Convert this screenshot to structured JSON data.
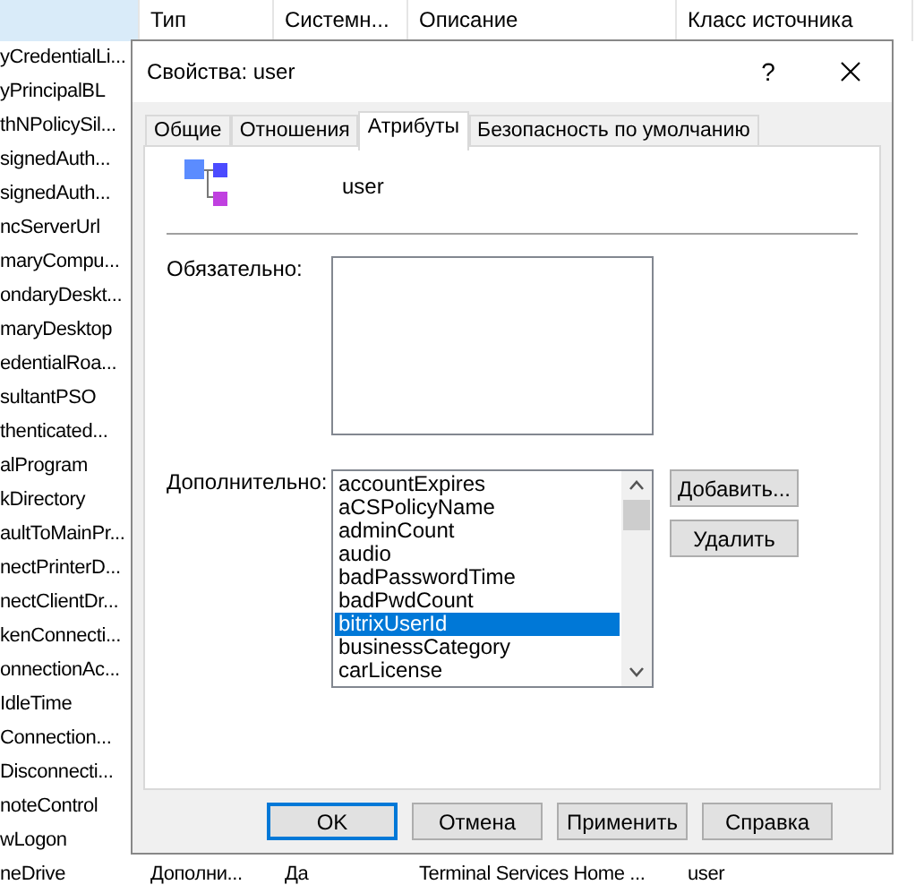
{
  "list": {
    "columns": [
      {
        "selected": true
      },
      {
        "label": "Тип",
        "selected": false
      },
      {
        "label": "Системн...",
        "selected": false
      },
      {
        "label": "Описание",
        "selected": false
      },
      {
        "label": "Класс источника",
        "selected": false
      }
    ],
    "rows": [
      {
        "cells": [
          "yCredentialLi..."
        ]
      },
      {
        "cells": [
          "yPrincipalBL"
        ]
      },
      {
        "cells": [
          "thNPolicySil..."
        ]
      },
      {
        "cells": [
          "signedAuth..."
        ]
      },
      {
        "cells": [
          "signedAuth..."
        ]
      },
      {
        "cells": [
          "ncServerUrl"
        ]
      },
      {
        "cells": [
          "maryCompu..."
        ]
      },
      {
        "cells": [
          "ondaryDeskt..."
        ]
      },
      {
        "cells": [
          "maryDesktop"
        ]
      },
      {
        "cells": [
          "edentialRoa..."
        ]
      },
      {
        "cells": [
          "sultantPSO"
        ]
      },
      {
        "cells": [
          "thenticated..."
        ]
      },
      {
        "cells": [
          "alProgram"
        ]
      },
      {
        "cells": [
          "kDirectory"
        ]
      },
      {
        "cells": [
          "aultToMainPr..."
        ]
      },
      {
        "cells": [
          "nectPrinterD..."
        ]
      },
      {
        "cells": [
          "nectClientDr..."
        ]
      },
      {
        "cells": [
          "kenConnecti..."
        ]
      },
      {
        "cells": [
          "onnectionAc..."
        ]
      },
      {
        "cells": [
          "IdleTime"
        ]
      },
      {
        "cells": [
          "Connection..."
        ]
      },
      {
        "cells": [
          "Disconnecti..."
        ]
      },
      {
        "cells": [
          "noteControl"
        ]
      },
      {
        "cells": [
          "wLogon"
        ]
      },
      {
        "cells": [
          "neDrive",
          "Дополни...",
          "Да",
          "Terminal Services Home ...",
          "user"
        ]
      }
    ]
  },
  "dialog": {
    "title": "Свойства: user",
    "help": "?",
    "tabs": [
      {
        "label": "Общие",
        "selected": false
      },
      {
        "label": "Отношения",
        "selected": false
      },
      {
        "label": "Атрибуты",
        "selected": true
      },
      {
        "label": "Безопасность по умолчанию",
        "selected": false
      }
    ],
    "object_name": "user",
    "mandatory": {
      "label": "Обязательно:"
    },
    "optional": {
      "label": "Дополнительно:",
      "items": [
        {
          "label": "accountExpires",
          "selected": false
        },
        {
          "label": "aCSPolicyName",
          "selected": false
        },
        {
          "label": "adminCount",
          "selected": false
        },
        {
          "label": "audio",
          "selected": false
        },
        {
          "label": "badPasswordTime",
          "selected": false
        },
        {
          "label": "badPwdCount",
          "selected": false
        },
        {
          "label": "bitrixUserId",
          "selected": true
        },
        {
          "label": "businessCategory",
          "selected": false
        },
        {
          "label": "carLicense",
          "selected": false
        }
      ],
      "buttons": [
        "Добавить...",
        "Удалить"
      ]
    },
    "buttons": [
      {
        "label": "OK",
        "default": true
      },
      {
        "label": "Отмена",
        "default": false
      },
      {
        "label": "Применить",
        "default": false
      },
      {
        "label": "Справка",
        "default": false
      }
    ]
  }
}
